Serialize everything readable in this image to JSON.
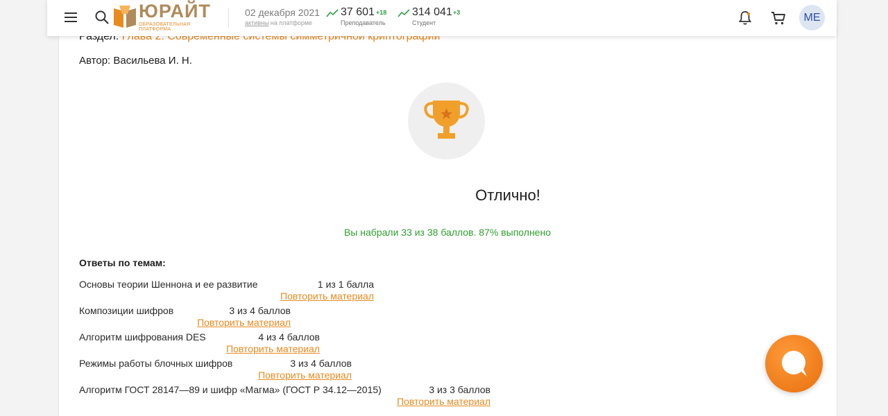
{
  "header": {
    "logo_name": "ЮРАЙТ",
    "logo_sub": "ОБРАЗОВАТЕЛЬНАЯ ПЛАТФОРМА",
    "date": "02 декабря 2021",
    "date_sub_link": "активны",
    "date_sub_rest": " на платформе",
    "stats": [
      {
        "value": "37 601",
        "delta": "+18",
        "label": "Преподаватель"
      },
      {
        "value": "314 041",
        "delta": "+3",
        "label": "Студент"
      }
    ],
    "avatar": "ME",
    "icons": {
      "menu": "hamburger-icon",
      "search": "search-icon",
      "bell": "bell-icon",
      "cart": "cart-icon"
    }
  },
  "content": {
    "section_label": "Раздел: ",
    "section_link": "Глава 2. Современные системы симметричной криптографии",
    "author": "Автор: Васильева И. Н.",
    "result_title": "Отлично!",
    "score_text": "Вы набрали 33 из 38 баллов. 87% выполнено",
    "answers_heading": "Ответы по темам:",
    "repeat_label": "Повторить материал",
    "rows": [
      {
        "topic": "Основы теории Шеннона и ее развитие",
        "points": "1 из 1 балла"
      },
      {
        "topic": "Композиции шифров",
        "points": "3 из 4 баллов"
      },
      {
        "topic": "Алгоритм шифрования DES",
        "points": "4 из 4 баллов"
      },
      {
        "topic": "Режимы работы блочных шифров",
        "points": "3 из 4 баллов"
      },
      {
        "topic": "Алгоритм ГОСТ 28147—89 и шифр «Магма» (ГОСТ Р 34.12—2015)",
        "points": "3 из 3 баллов"
      }
    ]
  },
  "colors": {
    "accent": "#e98a1f",
    "success": "#2ea02e",
    "chat": "#f08019"
  }
}
